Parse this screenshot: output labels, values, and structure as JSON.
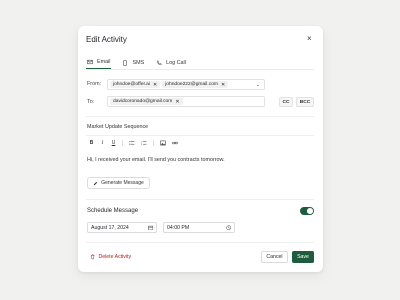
{
  "dialog": {
    "title": "Edit Activity",
    "close_icon": "close-icon"
  },
  "tabs": [
    {
      "label": "Email",
      "icon": "mail-icon",
      "active": true
    },
    {
      "label": "SMS",
      "icon": "phone-icon",
      "active": false
    },
    {
      "label": "Log Call",
      "icon": "call-icon",
      "active": false
    }
  ],
  "from": {
    "label": "From:",
    "chips": [
      "johndoe@offer.ai",
      "johndoe222@gmail.com"
    ]
  },
  "to": {
    "label": "To:",
    "chips": [
      "davidcoronado@gmail.com"
    ],
    "cc_label": "CC",
    "bcc_label": "BCC"
  },
  "email": {
    "subject": "Market Update Sequence",
    "toolbar": [
      "B",
      "I",
      "U",
      "bulleted-list-icon",
      "numbered-list-icon",
      "image-icon",
      "link-icon"
    ],
    "body": "Hi, I received your email. I'll send you contracts tomorrow.",
    "generate_label": "Generate Message"
  },
  "schedule": {
    "label": "Schedule Message",
    "enabled": true,
    "date": "August 17, 2024",
    "time": "04:00 PM"
  },
  "footer": {
    "delete_label": "Delete Activity",
    "cancel_label": "Cancel",
    "save_label": "Save"
  },
  "colors": {
    "accent": "#1f5c3f",
    "danger": "#b42318",
    "background": "#f1f1f0"
  }
}
